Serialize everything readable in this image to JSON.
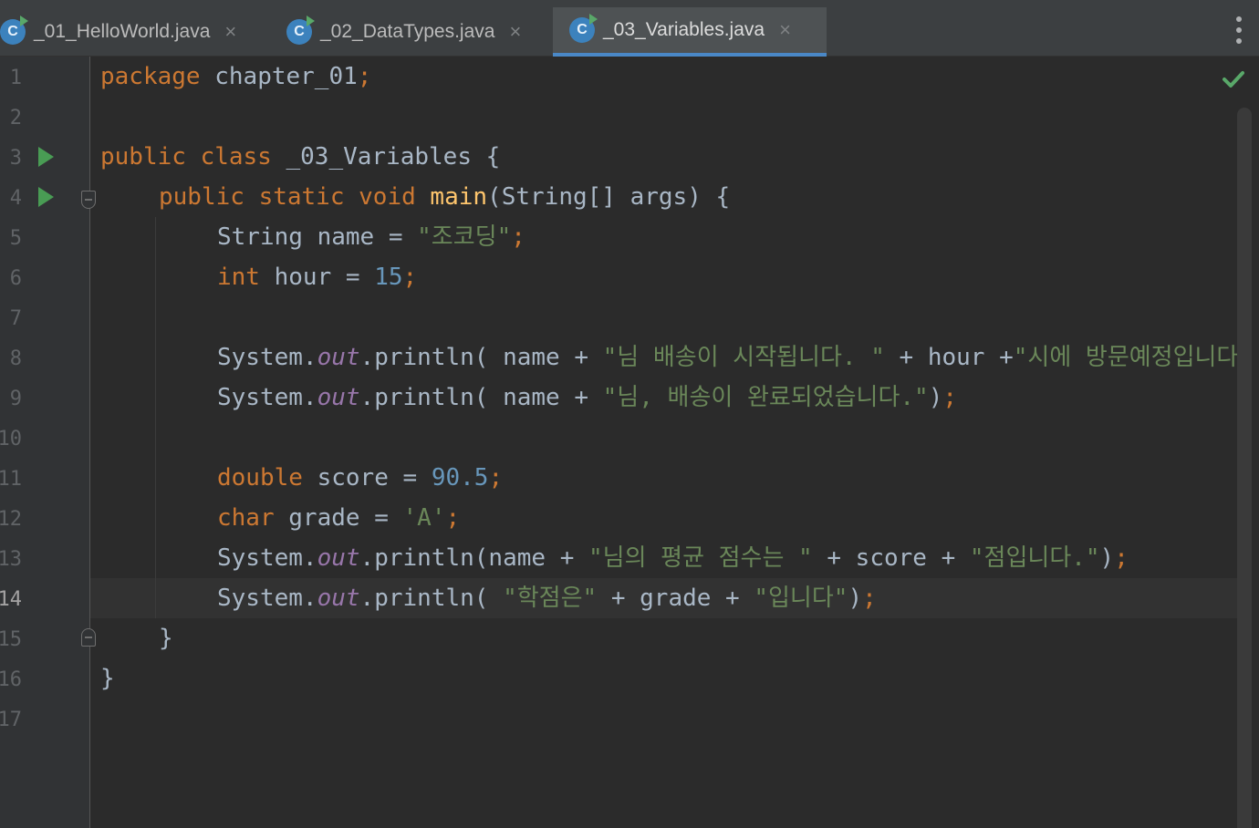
{
  "tabs": [
    {
      "label": "_01_HelloWorld.java",
      "active": false
    },
    {
      "label": "_02_DataTypes.java",
      "active": false
    },
    {
      "label": "_03_Variables.java",
      "active": true
    }
  ],
  "file_icon_letter": "C",
  "close_glyph": "×",
  "line_numbers": [
    "1",
    "2",
    "3",
    "4",
    "5",
    "6",
    "7",
    "8",
    "9",
    "10",
    "11",
    "12",
    "13",
    "14",
    "15",
    "16",
    "17"
  ],
  "current_line": 14,
  "code": {
    "l1": {
      "kw": "package",
      "rest": " chapter_01",
      "semi": ";"
    },
    "l3": {
      "kw": "public class",
      "rest": " _03_Variables {"
    },
    "l4": {
      "kw": "public static void",
      "fn": "main",
      "rest": "(String[] args) {"
    },
    "l5": {
      "pre": "String name = ",
      "str": "\"조코딩\"",
      "semi": ";"
    },
    "l6": {
      "kw": "int",
      "pre": " hour = ",
      "num": "15",
      "semi": ";"
    },
    "l8": {
      "pre": "System.",
      "field": "out",
      "mid": ".println( name + ",
      "str1": "\"님 배송이 시작됩니다. \"",
      "mid2": " + hour +",
      "str2": "\"시에 방문예정입니다.\"",
      "tail": ")"
    },
    "l9": {
      "pre": "System.",
      "field": "out",
      "mid": ".println( name + ",
      "str": "\"님, 배송이 완료되었습니다.\"",
      "tail": ")",
      "semi": ";"
    },
    "l11": {
      "kw": "double",
      "pre": " score = ",
      "num": "90.5",
      "semi": ";"
    },
    "l12": {
      "kw": "char",
      "pre": " grade = ",
      "str": "'A'",
      "semi": ";"
    },
    "l13": {
      "pre": "System.",
      "field": "out",
      "mid": ".println(name + ",
      "str1": "\"님의 평균 점수는 \"",
      "mid2": " + score + ",
      "str2": "\"점입니다.\"",
      "tail": ")",
      "semi": ";"
    },
    "l14": {
      "pre": "System.",
      "field": "out",
      "mid": ".println( ",
      "str1": "\"학점은\"",
      "mid2": " + grade + ",
      "str2": "\"입니다\"",
      "tail": ")",
      "semi": ";"
    },
    "l15": {
      "rest": "}"
    },
    "l16": {
      "rest": "}"
    }
  },
  "icons": {
    "run": "run-gutter-icon",
    "fold": "fold-icon",
    "status": "check-icon",
    "menu": "more-vertical-icon"
  },
  "colors": {
    "keyword": "#cc7832",
    "string": "#6a8759",
    "number": "#6897bb",
    "function": "#ffc66d",
    "field": "#9876aa",
    "plain": "#a9b7c6",
    "accent": "#4a88c7",
    "ok": "#59a869"
  }
}
